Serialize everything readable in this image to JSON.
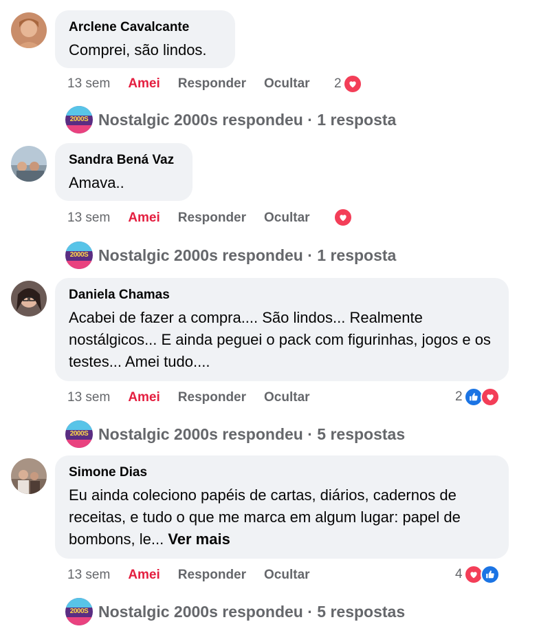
{
  "comments": [
    {
      "author": "Arclene Cavalcante",
      "text": "Comprei, são lindos.",
      "time": "13 sem",
      "reaction_label": "Amei",
      "reply_label": "Responder",
      "hide_label": "Ocultar",
      "reaction_count": "2",
      "reaction_icons": [
        "heart-icon"
      ],
      "reply_summary": "Nostalgic 2000s respondeu · 1 resposta"
    },
    {
      "author": "Sandra Bená Vaz",
      "text": "Amava..",
      "time": "13 sem",
      "reaction_label": "Amei",
      "reply_label": "Responder",
      "hide_label": "Ocultar",
      "reaction_count": "",
      "reaction_icons": [
        "heart-icon"
      ],
      "reply_summary": "Nostalgic 2000s respondeu · 1 resposta"
    },
    {
      "author": "Daniela Chamas",
      "text": "Acabei de fazer a compra.... São lindos... Realmente nostálgicos... E ainda peguei o pack com figurinhas, jogos e os testes... Amei tudo....",
      "time": "13 sem",
      "reaction_label": "Amei",
      "reply_label": "Responder",
      "hide_label": "Ocultar",
      "reaction_count": "2",
      "reaction_icons": [
        "like-icon",
        "heart-icon"
      ],
      "reply_summary": "Nostalgic 2000s respondeu · 5 respostas"
    },
    {
      "author": "Simone Dias",
      "text": "Eu ainda coleciono papéis de cartas, diários, cadernos de receitas, e tudo o que me marca em algum lugar: papel de bombons, le...",
      "see_more": "Ver mais",
      "time": "13 sem",
      "reaction_label": "Amei",
      "reply_label": "Responder",
      "hide_label": "Ocultar",
      "reaction_count": "4",
      "reaction_icons": [
        "heart-icon",
        "like-icon"
      ],
      "reply_summary": "Nostalgic 2000s respondeu · 5 respostas"
    }
  ],
  "page_avatar_text": "2000S",
  "colors": {
    "bubble": "#f0f2f5",
    "love": "#e41e3f",
    "muted": "#65676b",
    "heart": "#f33e58",
    "like": "#1b74e4"
  }
}
